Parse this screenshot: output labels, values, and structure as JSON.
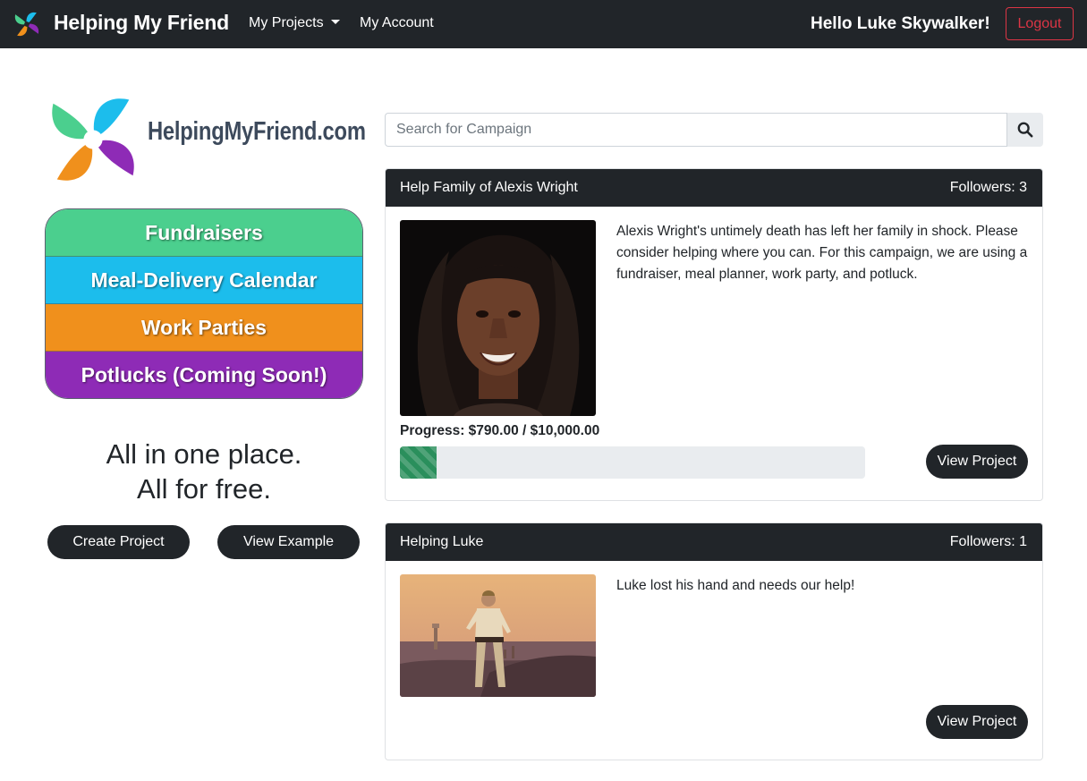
{
  "navbar": {
    "brand": "Helping My Friend",
    "projects_label": "My Projects",
    "account_label": "My Account",
    "greeting": "Hello Luke Skywalker!",
    "logout_label": "Logout"
  },
  "logo": {
    "text": "HelpingMyFriend.com",
    "colors": [
      "#1cbdec",
      "#8e2bb6",
      "#f0901c",
      "#4bcf8e"
    ]
  },
  "features": [
    {
      "label": "Fundraisers",
      "color": "#4bcf8e"
    },
    {
      "label": "Meal-Delivery Calendar",
      "color": "#1cbdec"
    },
    {
      "label": "Work Parties",
      "color": "#f0901c"
    },
    {
      "label": "Potlucks (Coming Soon!)",
      "color": "#8e2bb6"
    }
  ],
  "tagline": {
    "line1": "All in one place.",
    "line2": "All for free."
  },
  "actions": {
    "create": "Create Project",
    "example": "View Example"
  },
  "search": {
    "placeholder": "Search for Campaign",
    "icon": "search-icon"
  },
  "campaigns": [
    {
      "title": "Help Family of Alexis Wright",
      "followers": "Followers: 3",
      "description": "Alexis Wright's untimely death has left her family in shock. Please consider helping where you can. For this campaign, we are using a fundraiser, meal planner, work party, and potluck.",
      "progress_label": "Progress: $790.00 / $10,000.00",
      "progress_fraction": 0.079,
      "view_label": "View Project",
      "image": "portrait-photo"
    },
    {
      "title": "Helping Luke",
      "followers": "Followers: 1",
      "description": "Luke lost his hand and needs our help!",
      "view_label": "View Project",
      "image": "desert-photo"
    }
  ],
  "colors": {
    "navbar_bg": "#212529",
    "logout": "#dc3545",
    "progress": "#2a8f5c"
  }
}
